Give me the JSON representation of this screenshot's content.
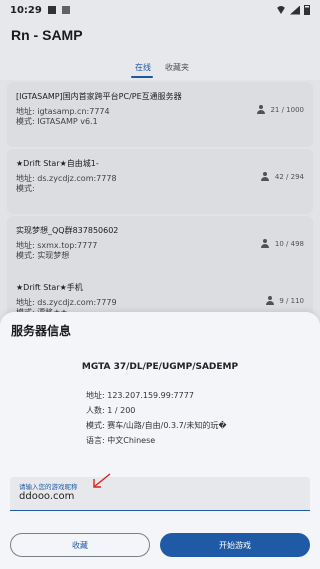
{
  "status": {
    "time": "10:29"
  },
  "app": {
    "title": "Rn - SAMP"
  },
  "tabs": [
    {
      "label": "在线"
    },
    {
      "label": "收藏夹"
    }
  ],
  "servers": [
    {
      "name": "[IGTASAMP]国内首家跨平台PC/PE互通服务器",
      "address": "地址: igtasamp.cn:7774",
      "mode": "模式: IGTASAMP v6.1",
      "players": "21 / 1000"
    },
    {
      "name": "★Drift Star★自由城1-",
      "address": "地址: ds.zycdjz.com:7778",
      "mode": "模式:",
      "players": "42 / 294"
    },
    {
      "name": "实现梦想_QQ群837850602",
      "address": "地址: sxmx.top:7777",
      "mode": "模式: 实现梦想",
      "players": "10 / 498"
    },
    {
      "name": "★Drift Star★手机",
      "address": "地址: ds.zycdjz.com:7779",
      "mode": "模式: 漂移★★",
      "players": "9 / 110"
    }
  ],
  "dialog": {
    "title": "服务器信息",
    "server_name": "MGTA 37/DL/PE/UGMP/SADEMP",
    "address": "地址: 123.207.159.99:7777",
    "players": "人数: 1 / 200",
    "mode": "模式: 赛车/山路/自由/0.3.7/未知的玩�",
    "language": "语言: 中文Chinese",
    "input_label": "请输入您的游戏昵称",
    "input_value": "ddooo.com",
    "fav_button": "收藏",
    "start_button": "开始游戏"
  },
  "colors": {
    "accent": "#1f5aa6",
    "annotation_arrow": "#e0201c"
  }
}
